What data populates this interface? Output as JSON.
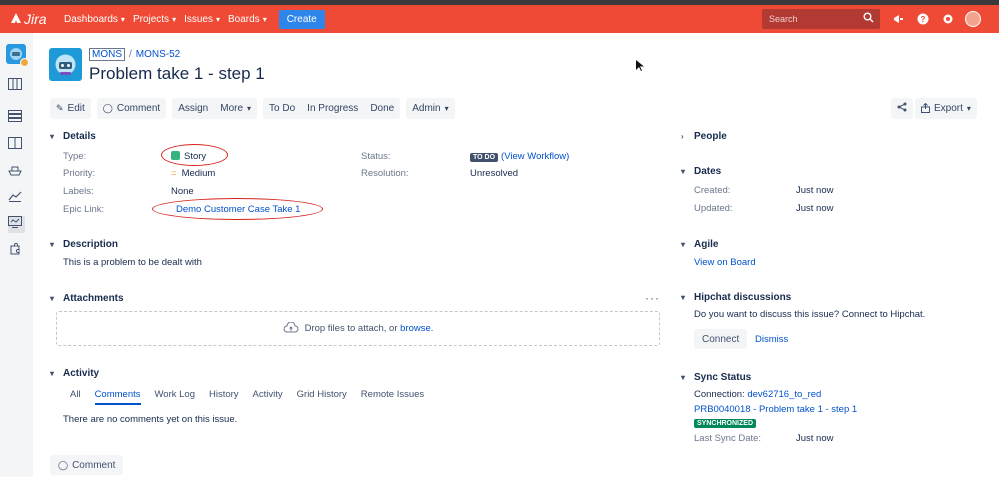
{
  "nav": {
    "logo": "Jira",
    "items": [
      {
        "label": "Dashboards"
      },
      {
        "label": "Projects"
      },
      {
        "label": "Issues"
      },
      {
        "label": "Boards"
      }
    ],
    "create": "Create",
    "search_placeholder": "Search"
  },
  "colors": {
    "nav_bg": "#ef4a36",
    "create_btn": "#2e86ea",
    "link": "#0052cc",
    "highlight_oval": "#d6231c",
    "synchronized": "#00875a"
  },
  "icons": [
    "atlassian-icon",
    "search-icon",
    "megaphone-icon",
    "help-icon",
    "gear-icon",
    "avatar",
    "sidebar-board-icon",
    "sidebar-backlog-icon",
    "sidebar-columns-icon",
    "sidebar-ship-icon",
    "sidebar-reports-icon",
    "sidebar-issues-icon",
    "sidebar-addons-icon",
    "share-icon",
    "export-icon"
  ],
  "breadcrumb": {
    "project": "MONS",
    "sep": "/",
    "issue_key": "MONS-52"
  },
  "title": "Problem take 1 - step 1",
  "toolbar": {
    "edit": "Edit",
    "comment": "Comment",
    "assign": "Assign",
    "more": "More",
    "todo": "To Do",
    "inprogress": "In Progress",
    "done": "Done",
    "admin": "Admin",
    "export": "Export"
  },
  "details": {
    "heading": "Details",
    "type_label": "Type:",
    "type_value": "Story",
    "priority_label": "Priority:",
    "priority_value": "Medium",
    "labels_label": "Labels:",
    "labels_value": "None",
    "epic_label": "Epic Link:",
    "epic_value": "Demo Customer Case Take 1",
    "status_label": "Status:",
    "status_lozenge": "TO DO",
    "status_link": "(View Workflow)",
    "resolution_label": "Resolution:",
    "resolution_value": "Unresolved"
  },
  "description": {
    "heading": "Description",
    "text": "This is a problem to be dealt with"
  },
  "attachments": {
    "heading": "Attachments",
    "drop_text": "Drop files to attach, or",
    "browse": "browse."
  },
  "activity": {
    "heading": "Activity",
    "tabs": [
      "All",
      "Comments",
      "Work Log",
      "History",
      "Activity",
      "Grid History",
      "Remote Issues"
    ],
    "active_tab": "Comments",
    "empty": "There are no comments yet on this issue.",
    "comment_button": "Comment"
  },
  "people": {
    "heading": "People"
  },
  "dates": {
    "heading": "Dates",
    "created_label": "Created:",
    "created_value": "Just now",
    "updated_label": "Updated:",
    "updated_value": "Just now"
  },
  "agile": {
    "heading": "Agile",
    "link": "View on Board"
  },
  "hipchat": {
    "heading": "Hipchat discussions",
    "text": "Do you want to discuss this issue? Connect to Hipchat.",
    "connect": "Connect",
    "dismiss": "Dismiss"
  },
  "sync": {
    "heading": "Sync Status",
    "connection_label": "Connection:",
    "connection_value": "dev62716_to_red",
    "record": "PRB0040018 - Problem take 1 - step 1",
    "status": "SYNCHRONIZED",
    "last_label": "Last Sync Date:",
    "last_value": "Just now"
  }
}
